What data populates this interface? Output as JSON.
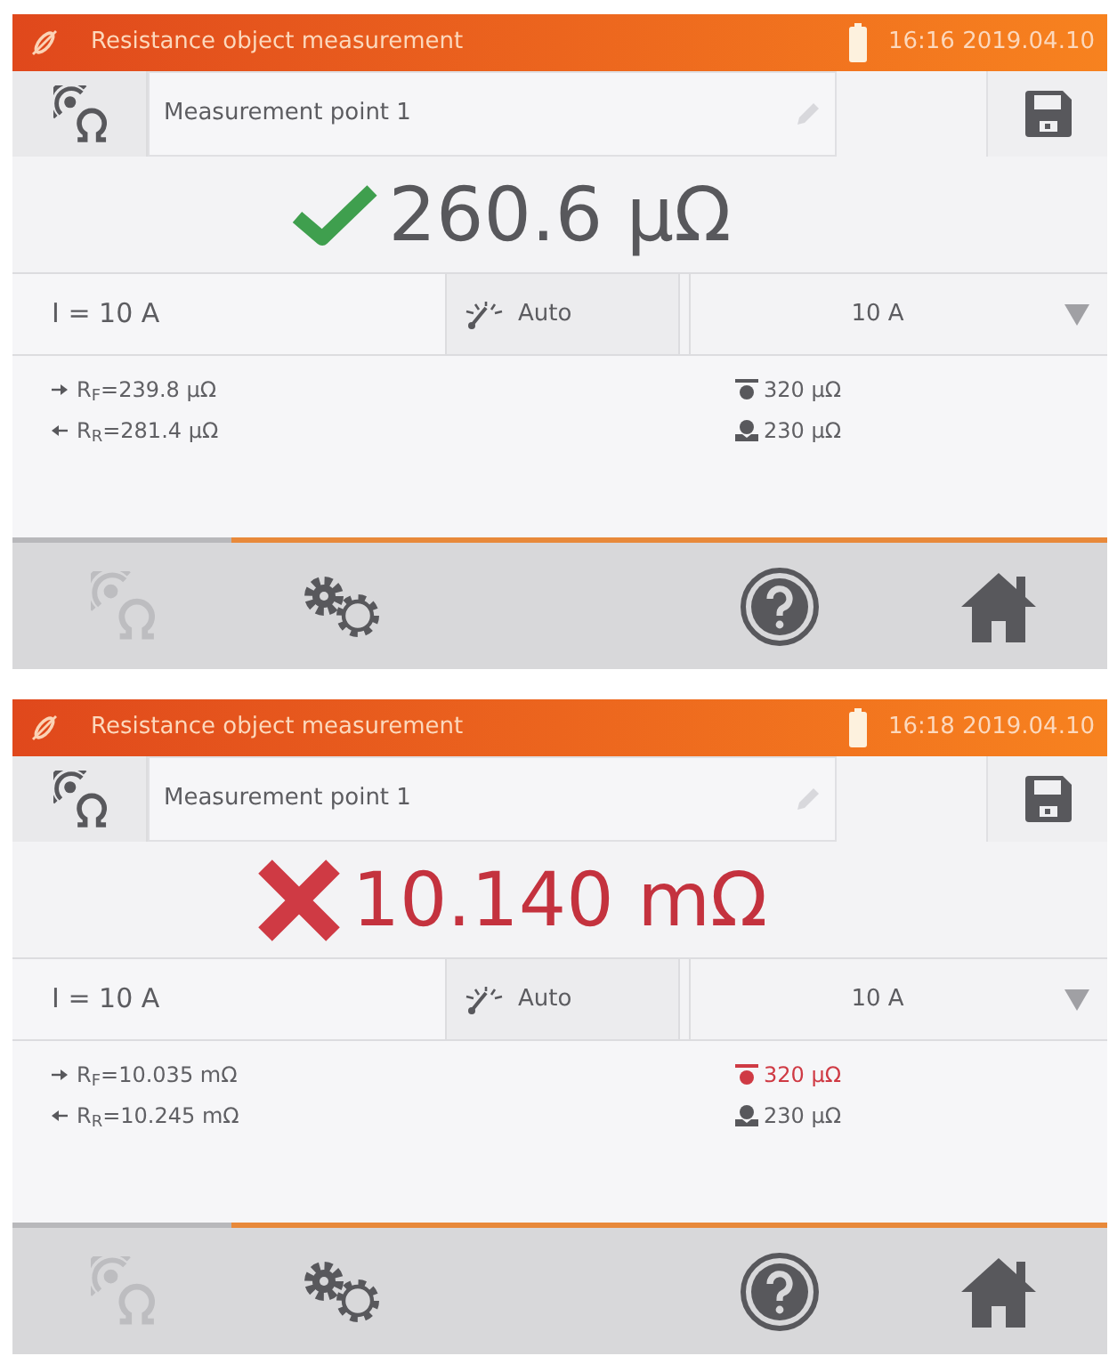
{
  "screens": [
    {
      "title_bar": {
        "title": "Resistance object measurement",
        "time": "16:16 2019.04.10"
      },
      "name_field": {
        "value": "Measurement point 1"
      },
      "result": {
        "kind": "pass",
        "value": "260.6 μΩ"
      },
      "settings": {
        "current": "I = 10 A",
        "mode": "Auto",
        "range": "10 A"
      },
      "readings": [
        {
          "kind": "forward",
          "text": "R$_{F}$=239.8 μΩ"
        },
        {
          "kind": "reverse",
          "text": "R$_{R}$=281.4 μΩ"
        }
      ],
      "limits": [
        {
          "kind": "upper",
          "text": "320 μΩ",
          "exceeded": false
        },
        {
          "kind": "lower",
          "text": "230 μΩ",
          "exceeded": false
        }
      ],
      "nav": {
        "left": [
          {
            "kind": "measure",
            "disabled": true
          },
          {
            "kind": "settings",
            "disabled": false
          }
        ],
        "right": [
          {
            "kind": "help",
            "disabled": false
          },
          {
            "kind": "home",
            "disabled": false
          }
        ]
      }
    },
    {
      "title_bar": {
        "title": "Resistance object measurement",
        "time": "16:18 2019.04.10"
      },
      "name_field": {
        "value": "Measurement point 1"
      },
      "result": {
        "kind": "fail",
        "value": "10.140 mΩ"
      },
      "settings": {
        "current": "I = 10 A",
        "mode": "Auto",
        "range": "10 A"
      },
      "readings": [
        {
          "kind": "forward",
          "text": "R$_{F}$=10.035 mΩ"
        },
        {
          "kind": "reverse",
          "text": "R$_{R}$=10.245 mΩ"
        }
      ],
      "limits": [
        {
          "kind": "upper",
          "text": "320 μΩ",
          "exceeded": true
        },
        {
          "kind": "lower",
          "text": "230 μΩ",
          "exceeded": false
        }
      ],
      "nav": {
        "left": [
          {
            "kind": "measure",
            "disabled": true
          },
          {
            "kind": "settings",
            "disabled": false
          }
        ],
        "right": [
          {
            "kind": "help",
            "disabled": false
          },
          {
            "kind": "home",
            "disabled": false
          }
        ]
      }
    }
  ]
}
